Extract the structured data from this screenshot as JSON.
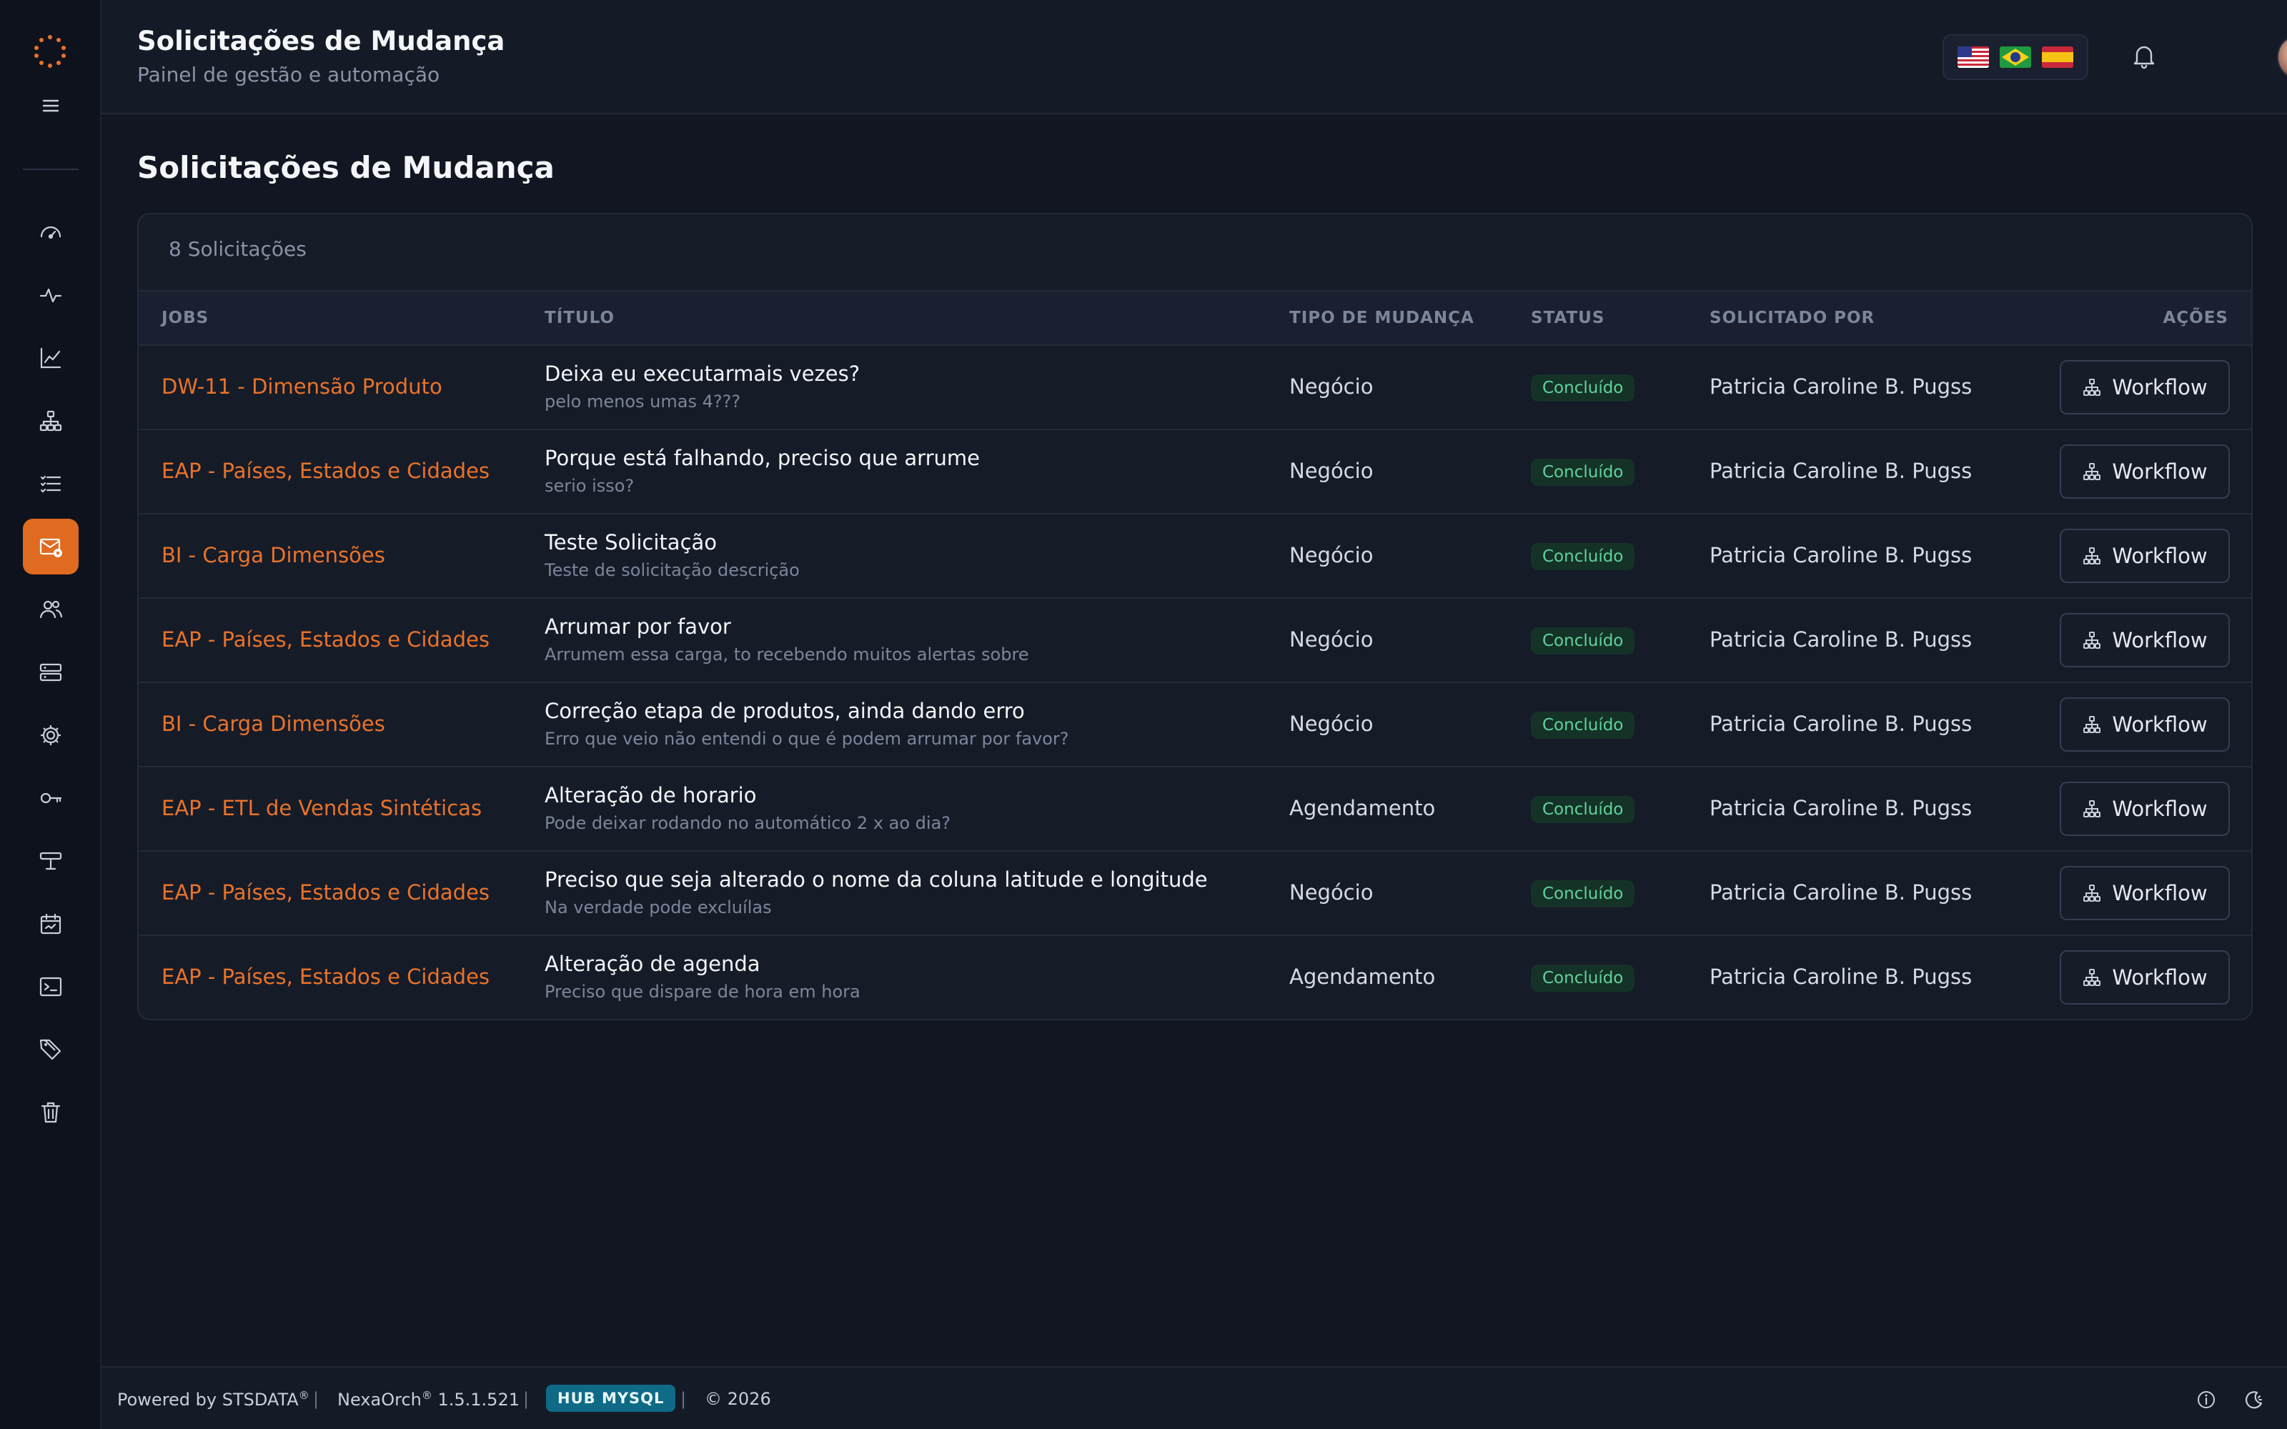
{
  "header": {
    "title": "Solicitações de Mudança",
    "subtitle": "Painel de gestão e automação",
    "flags": [
      "us-flag",
      "br-flag",
      "es-flag"
    ]
  },
  "page": {
    "title": "Solicitações de Mudança",
    "count": "8 Solicitações"
  },
  "table": {
    "headers": {
      "jobs": "JOBS",
      "titulo": "TÍTULO",
      "tipo": "TIPO DE MUDANÇA",
      "status": "STATUS",
      "solicitado": "SOLICITADO POR",
      "acoes": "AÇÕES"
    },
    "rows": [
      {
        "job": "DW-11 - Dimensão Produto",
        "title": "Deixa eu executarmais vezes?",
        "desc": "pelo menos umas 4???",
        "type": "Negócio",
        "status": "Concluído",
        "by": "Patricia Caroline B. Pugss",
        "action": "Workflow"
      },
      {
        "job": "EAP - Países, Estados e Cidades",
        "title": "Porque está falhando, preciso que arrume",
        "desc": "serio isso?",
        "type": "Negócio",
        "status": "Concluído",
        "by": "Patricia Caroline B. Pugss",
        "action": "Workflow"
      },
      {
        "job": "BI - Carga Dimensões",
        "title": "Teste Solicitação",
        "desc": "Teste de solicitação descrição",
        "type": "Negócio",
        "status": "Concluído",
        "by": "Patricia Caroline B. Pugss",
        "action": "Workflow"
      },
      {
        "job": "EAP - Países, Estados e Cidades",
        "title": "Arrumar por favor",
        "desc": "Arrumem essa carga, to recebendo muitos alertas sobre",
        "type": "Negócio",
        "status": "Concluído",
        "by": "Patricia Caroline B. Pugss",
        "action": "Workflow"
      },
      {
        "job": "BI - Carga Dimensões",
        "title": "Correção etapa de produtos, ainda dando erro",
        "desc": "Erro que veio não entendi o que é podem arrumar por favor?",
        "type": "Negócio",
        "status": "Concluído",
        "by": "Patricia Caroline B. Pugss",
        "action": "Workflow"
      },
      {
        "job": "EAP - ETL de Vendas Sintéticas",
        "title": "Alteração de horario",
        "desc": "Pode deixar rodando no automático 2 x ao dia?",
        "type": "Agendamento",
        "status": "Concluído",
        "by": "Patricia Caroline B. Pugss",
        "action": "Workflow"
      },
      {
        "job": "EAP - Países, Estados e Cidades",
        "title": "Preciso que seja alterado o nome da coluna latitude e longitude",
        "desc": "Na verdade pode excluílas",
        "type": "Negócio",
        "status": "Concluído",
        "by": "Patricia Caroline B. Pugss",
        "action": "Workflow"
      },
      {
        "job": "EAP - Países, Estados e Cidades",
        "title": "Alteração de agenda",
        "desc": "Preciso que dispare de hora em hora",
        "type": "Agendamento",
        "status": "Concluído",
        "by": "Patricia Caroline B. Pugss",
        "action": "Workflow"
      }
    ]
  },
  "footer": {
    "powered": "Powered by STSDATA",
    "powered_reg": "®",
    "sep": "|",
    "product": "NexaOrch",
    "product_reg": "®",
    "version": "1.5.1.521",
    "hub": "HUB MYSQL",
    "copyright": "© 2026"
  },
  "colors": {
    "accent": "#e06a1f",
    "job_link": "#e8732a",
    "status_bg": "#153227",
    "status_text": "#5fd39a",
    "hub_badge": "#0f6a86"
  },
  "sidebar": {
    "icons": [
      "dashboard-icon",
      "activity-icon",
      "chart-icon",
      "hierarchy-icon",
      "list-icon",
      "mail-settings-icon",
      "users-icon",
      "server-icon",
      "gear-icon",
      "key-icon",
      "sliders-icon",
      "calendar-icon",
      "terminal-icon",
      "tags-icon",
      "trash-icon"
    ],
    "active_index": 5
  }
}
